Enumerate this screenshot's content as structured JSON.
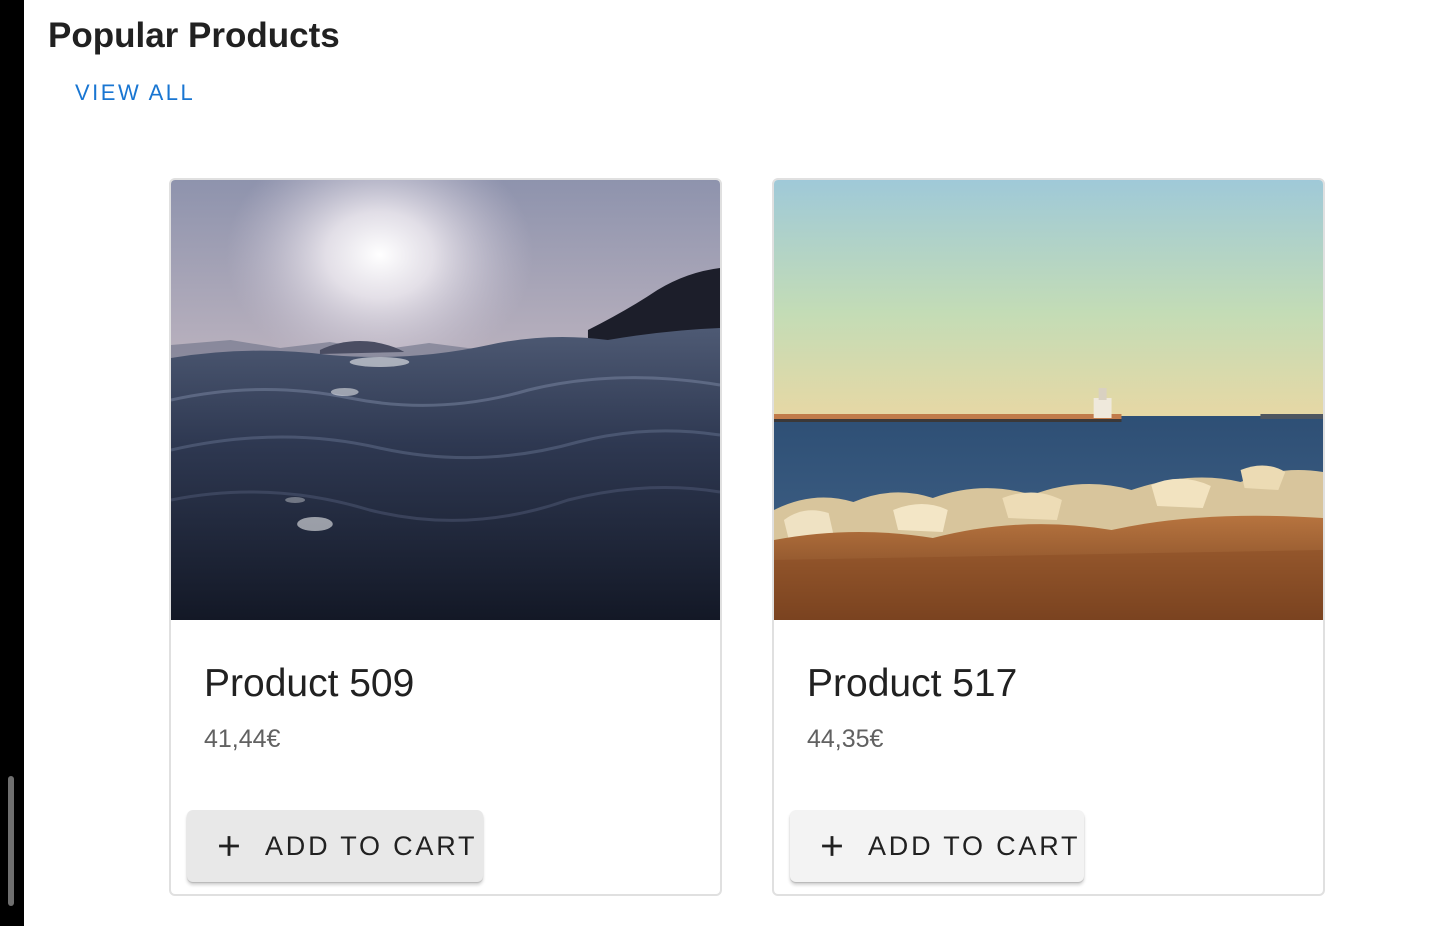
{
  "section": {
    "title": "Popular Products",
    "view_all_label": "VIEW ALL"
  },
  "products": [
    {
      "name": "Product 509",
      "price": "41,44€",
      "image": "ocean-waves-sunset-photo",
      "add_label": "ADD TO CART",
      "add_icon": "plus-icon"
    },
    {
      "name": "Product 517",
      "price": "44,35€",
      "image": "lighthouse-shore-photo",
      "add_label": "ADD TO CART",
      "add_icon": "plus-icon"
    }
  ],
  "colors": {
    "accent": "#1976d2",
    "text_primary": "#212121",
    "text_secondary": "#616161"
  }
}
